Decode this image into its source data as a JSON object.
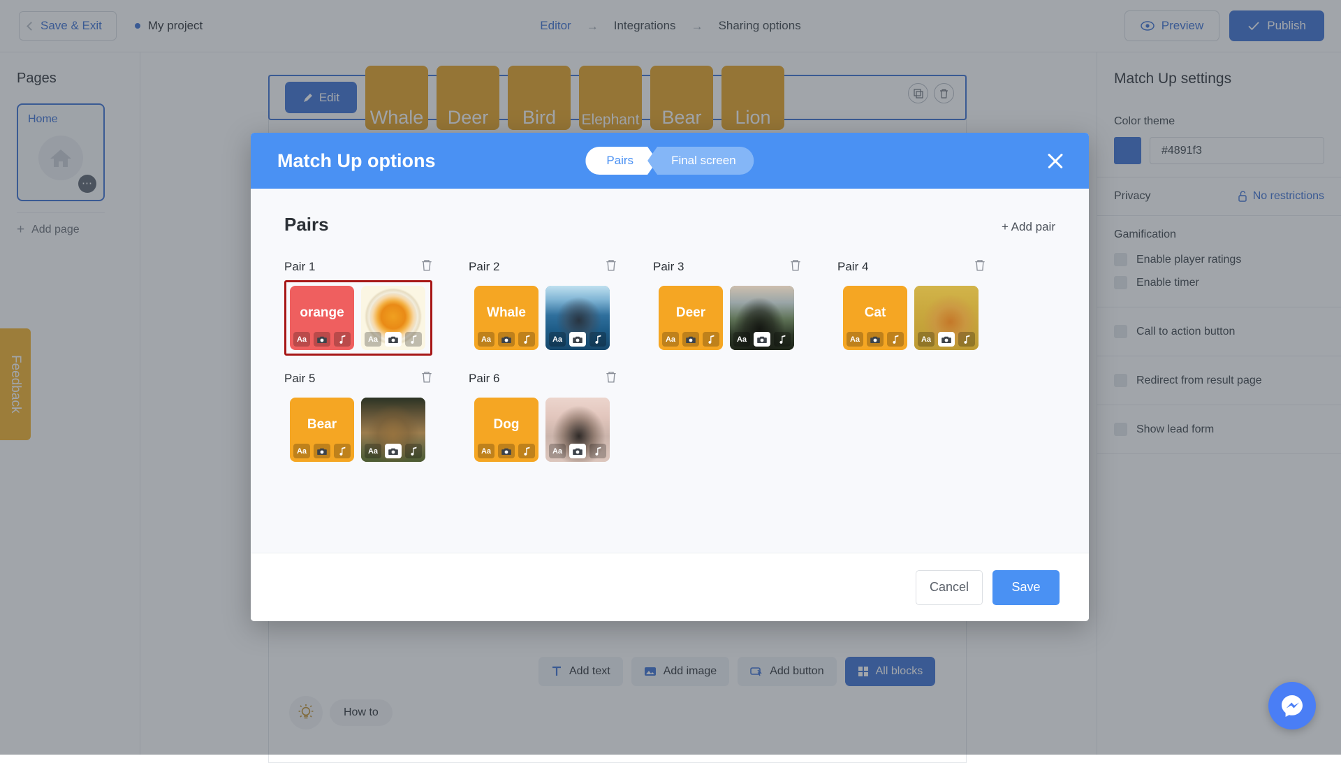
{
  "topbar": {
    "save_exit": "Save & Exit",
    "project_name": "My project",
    "breadcrumb": [
      "Editor",
      "Integrations",
      "Sharing options"
    ],
    "preview": "Preview",
    "publish": "Publish"
  },
  "pages_panel": {
    "title": "Pages",
    "page_label": "Home",
    "add_page": "Add page"
  },
  "canvas": {
    "edit_label": "Edit",
    "word_tiles": [
      "Whale",
      "Deer",
      "Bird",
      "Elephant",
      "Bear",
      "Lion"
    ],
    "add_buttons": [
      "Add text",
      "Add image",
      "Add button",
      "All blocks"
    ],
    "howto": "How to",
    "feedback": "Feedback"
  },
  "settings": {
    "title": "Match Up settings",
    "color_theme_label": "Color theme",
    "color_theme_value": "#4891f3",
    "color_swatch": "#3b6fd4",
    "privacy_label": "Privacy",
    "privacy_value": "No restrictions",
    "gamification_label": "Gamification",
    "checkboxes": [
      "Enable player ratings",
      "Enable timer",
      "Call to action button",
      "Redirect from result page",
      "Show lead form"
    ]
  },
  "modal": {
    "title": "Match Up options",
    "steps": [
      {
        "label": "Pairs",
        "active": true
      },
      {
        "label": "Final screen",
        "active": false
      }
    ],
    "pairs_title": "Pairs",
    "add_pair": "+ Add pair",
    "cancel": "Cancel",
    "save": "Save",
    "card_icons": [
      "text-icon",
      "camera-icon",
      "music-note-icon"
    ],
    "pairs": [
      {
        "label": "Pair 1",
        "selected": true,
        "left": {
          "type": "text",
          "text": "orange",
          "color": "#ef5f5f"
        },
        "right": {
          "type": "image",
          "alt": "orange-slice-photo",
          "color": "#fbf6e3"
        }
      },
      {
        "label": "Pair 2",
        "selected": false,
        "left": {
          "type": "text",
          "text": "Whale",
          "color": "#f5a623"
        },
        "right": {
          "type": "image",
          "alt": "whale-photo",
          "color": "#4f86ae"
        }
      },
      {
        "label": "Pair 3",
        "selected": false,
        "left": {
          "type": "text",
          "text": "Deer",
          "color": "#f5a623"
        },
        "right": {
          "type": "image",
          "alt": "deer-photo",
          "color": "#6c7c6a"
        }
      },
      {
        "label": "Pair 4",
        "selected": false,
        "left": {
          "type": "text",
          "text": "Cat",
          "color": "#f5a623"
        },
        "right": {
          "type": "image",
          "alt": "cat-photo",
          "color": "#c9a83e"
        }
      },
      {
        "label": "Pair 5",
        "selected": false,
        "left": {
          "type": "text",
          "text": "Bear",
          "color": "#f5a623"
        },
        "right": {
          "type": "image",
          "alt": "bear-photo",
          "color": "#5c5b45"
        }
      },
      {
        "label": "Pair 6",
        "selected": false,
        "left": {
          "type": "text",
          "text": "Dog",
          "color": "#f5a623"
        },
        "right": {
          "type": "image",
          "alt": "dog-photo",
          "color": "#e8cfc8"
        }
      }
    ]
  }
}
